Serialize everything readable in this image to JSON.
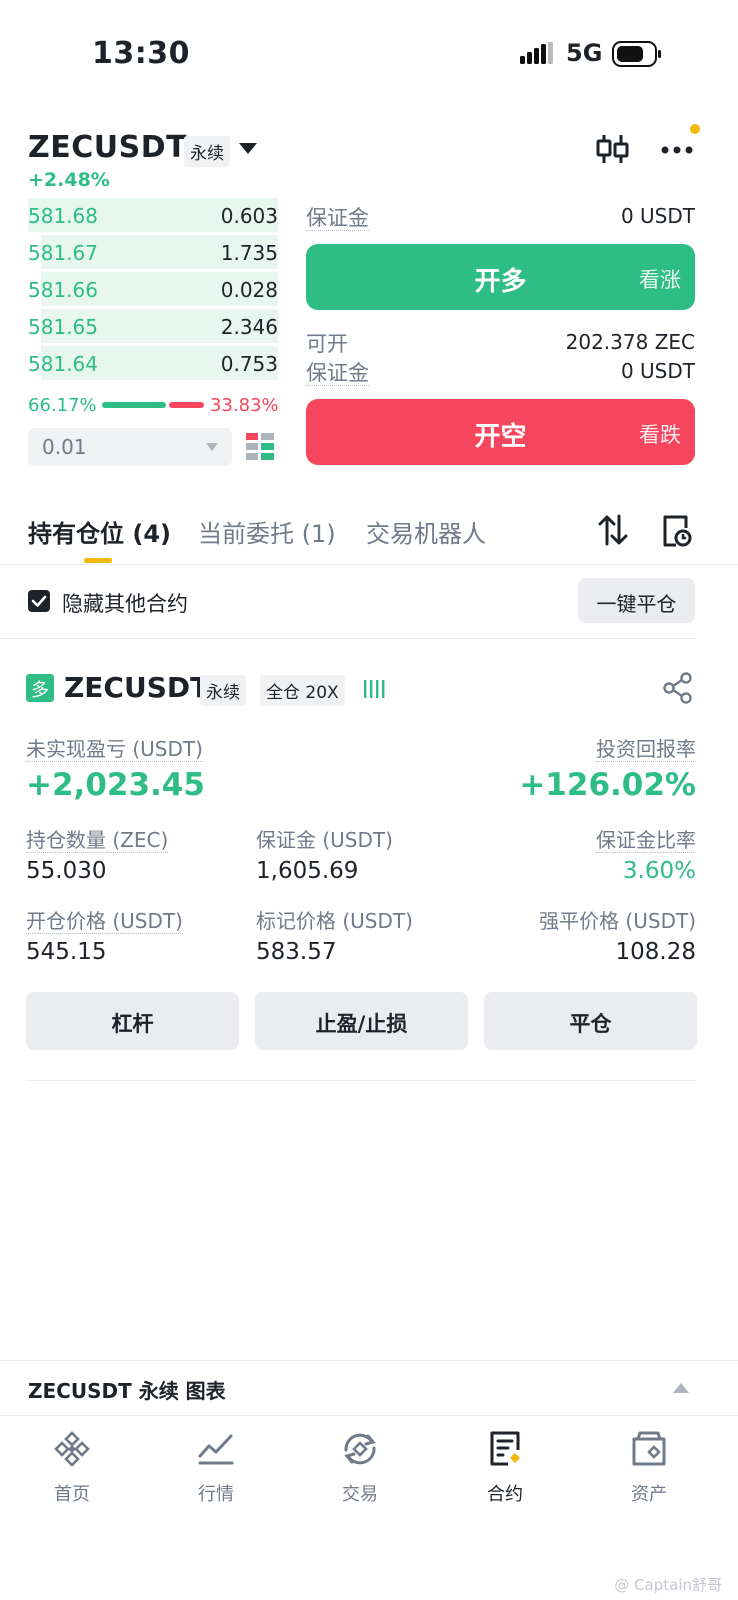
{
  "status_bar": {
    "time": "13:30",
    "network": "5G"
  },
  "header": {
    "symbol": "ZECUSDT",
    "contract_type": "永续",
    "change_percent": "+2.48%",
    "icons": [
      "candlestick-icon",
      "more-icon"
    ]
  },
  "order_book": {
    "rows": [
      {
        "price": "581.68",
        "qty": "0.603",
        "depth": 1.0
      },
      {
        "price": "581.67",
        "qty": "1.735",
        "depth": 0.95
      },
      {
        "price": "581.66",
        "qty": "0.028",
        "depth": 0.95
      },
      {
        "price": "581.65",
        "qty": "2.346",
        "depth": 0.95
      },
      {
        "price": "581.64",
        "qty": "0.753",
        "depth": 0.95
      }
    ],
    "buy_ratio": "66.17%",
    "sell_ratio": "33.83%",
    "buy_fraction": 0.6617,
    "precision": "0.01"
  },
  "trade_panel": {
    "margin_label": "保证金",
    "margin_value": "0 USDT",
    "long_button": "开多",
    "long_sub": "看涨",
    "can_open_label": "可开",
    "can_open_value": "202.378 ZEC",
    "margin_label2": "保证金",
    "margin_value2": "0 USDT",
    "short_button": "开空",
    "short_sub": "看跌"
  },
  "tabs": {
    "positions": "持有仓位 (4)",
    "orders": "当前委托 (1)",
    "bots": "交易机器人"
  },
  "filter": {
    "hide_other": "隐藏其他合约",
    "close_all": "一键平仓"
  },
  "position": {
    "side": "多",
    "symbol": "ZECUSDT",
    "type": "永续",
    "margin_mode": "全仓 20X",
    "unrealized_label": "未实现盈亏 (USDT)",
    "unrealized_value": "+2,023.45",
    "roi_label": "投资回报率",
    "roi_value": "+126.02%",
    "size_label": "持仓数量 (ZEC)",
    "size_value": "55.030",
    "margin_label": "保证金 (USDT)",
    "margin_value": "1,605.69",
    "margin_ratio_label": "保证金比率",
    "margin_ratio_value": "3.60%",
    "entry_label": "开仓价格 (USDT)",
    "entry_value": "545.15",
    "mark_label": "标记价格 (USDT)",
    "mark_value": "583.57",
    "liq_label": "强平价格 (USDT)",
    "liq_value": "108.28",
    "btn_leverage": "杠杆",
    "btn_tpsl": "止盈/止损",
    "btn_close": "平仓"
  },
  "chart_bar": {
    "label": "ZECUSDT 永续 图表"
  },
  "bottom_nav": {
    "items": [
      {
        "label": "首页",
        "icon": "home-icon"
      },
      {
        "label": "行情",
        "icon": "markets-icon"
      },
      {
        "label": "交易",
        "icon": "trade-icon"
      },
      {
        "label": "合约",
        "icon": "futures-icon"
      },
      {
        "label": "资产",
        "icon": "wallet-icon"
      }
    ]
  },
  "watermark": "@ Captain舒哥",
  "colors": {
    "green": "#2ebd85",
    "red": "#f6465d",
    "yellow": "#f0b90b",
    "text": "#1e2329"
  }
}
